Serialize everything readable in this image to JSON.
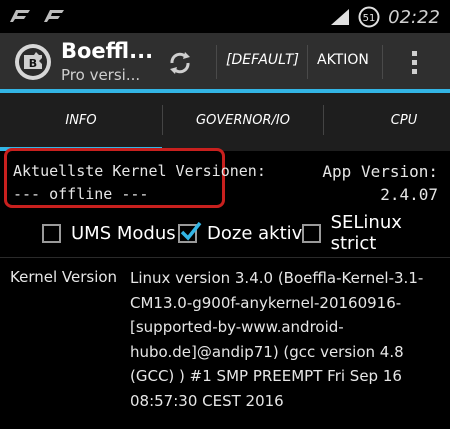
{
  "status_bar": {
    "time": "02:22",
    "icons": [
      "notification-icon-1",
      "notification-icon-2",
      "signal-icon",
      "battery-icon"
    ]
  },
  "action_bar": {
    "title": "Boeffl...",
    "subtitle": "Pro versi...",
    "refresh_icon": "refresh-icon",
    "default_label": "[DEFAULT]",
    "aktion_label": "AKTION",
    "overflow_icon": "overflow-menu-icon"
  },
  "tabs": [
    {
      "label": "INFO",
      "selected": true
    },
    {
      "label": "GOVERNOR/IO",
      "selected": false
    },
    {
      "label": "CPU",
      "selected": false
    }
  ],
  "info": {
    "kernel_versions_label": "Aktuellste Kernel Versionen:",
    "kernel_versions_value": "--- offline ---",
    "app_version_label": "App Version:",
    "app_version_value": "2.4.07"
  },
  "checkboxes": [
    {
      "label": "UMS Modus",
      "checked": false
    },
    {
      "label": "Doze aktiv",
      "checked": true
    },
    {
      "label": "SELinux strict",
      "checked": false
    }
  ],
  "kernel_version": {
    "label": "Kernel Version",
    "value": "Linux version 3.4.0 (Boeffla-Kernel-3.1-CM13.0-g900f-anykernel-20160916-[supported-by-www.android-hubo.de]@andip71) (gcc version 4.8 (GCC) ) #1 SMP PREEMPT Fri Sep 16 08:57:30 CEST 2016"
  },
  "colors": {
    "accent": "#33b5e5",
    "highlight_border": "#c8201e",
    "checkmark": "#33b5e5"
  }
}
